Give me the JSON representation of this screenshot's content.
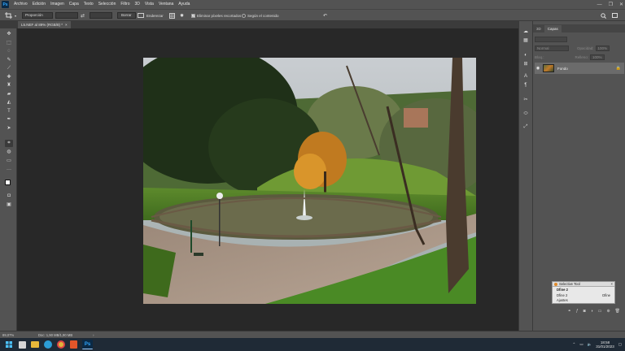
{
  "app": {
    "logo": "Ps",
    "menu": [
      "Archivo",
      "Edición",
      "Imagen",
      "Capa",
      "Texto",
      "Selección",
      "Filtro",
      "3D",
      "Vista",
      "Ventana",
      "Ayuda"
    ],
    "window_controls": [
      "—",
      "❐",
      "✕"
    ]
  },
  "options": {
    "ratio_select": "Proporción",
    "clear_button": "Borrar",
    "straighten_label": "Enderezar",
    "delete_cropped_label": "Eliminar píxeles recortados",
    "content_aware_label": "Según el contenido"
  },
  "document": {
    "tab_title": "L5.NEF al 89% (RGB/8) *",
    "close_glyph": "×"
  },
  "layers": {
    "tab_inactive": "3D",
    "tab_active": "Capas",
    "kind_filter": "Normal",
    "opacity_label": "Opacidad:",
    "opacity_value": "100%",
    "fill_label": "Relleno:",
    "fill_value": "100%",
    "lock_label": "Bloq.:",
    "layer_name": "Fondo"
  },
  "selective_tool": {
    "title": "Selective Tool",
    "item_1": "Dfine 2",
    "item_2": "Dfine 2",
    "item_2_right": "Dfine",
    "item_3": "Ajustes"
  },
  "status": {
    "zoom": "89,07%",
    "doc_info": "Doc: 1,90 MB/1,90 MB",
    "arrow": "›"
  },
  "taskbar": {
    "time": "18:58",
    "date": "31/01/2023",
    "ps_icon": "Ps"
  },
  "colors": {
    "ui_gray": "#535353",
    "canvas_bg": "#282828",
    "ps_blue": "#31a8ff",
    "taskbar": "#1f2a36"
  }
}
